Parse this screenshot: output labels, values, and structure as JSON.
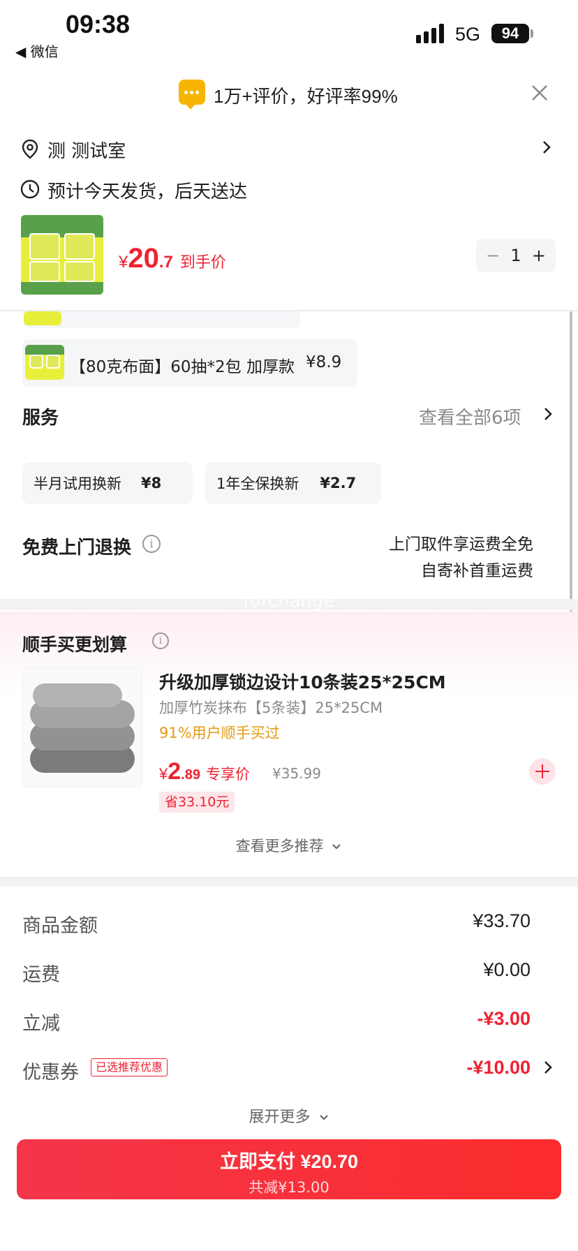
{
  "status_bar": {
    "time": "09:38",
    "back_label": "◀ 微信",
    "network": "5G",
    "battery": "94"
  },
  "review_banner": {
    "text": "1万+评价，好评率99%"
  },
  "address": {
    "text": "测 测试室"
  },
  "delivery": {
    "text": "预计今天发货，后天送达"
  },
  "product": {
    "price_currency": "¥",
    "price_integer": "20",
    "price_decimal": ".7",
    "price_tag": "到手价",
    "quantity": "1",
    "minus": "−",
    "plus": "+"
  },
  "sku": {
    "option_label": "【80克布面】60抽*2包 加厚款",
    "option_price": "¥8.9"
  },
  "services": {
    "title": "服务",
    "view_all": "查看全部6项",
    "chips": [
      {
        "name": "半月试用换新",
        "price": "¥8"
      },
      {
        "name": "1年全保换新",
        "price": "¥2.7"
      }
    ],
    "return_title": "免费上门退换",
    "return_line1": "上门取件享运费全免",
    "return_line2": "自寄补首重运费"
  },
  "watermark": "forchange",
  "recommend": {
    "title": "顺手买更划算",
    "item_name": "升级加厚锁边设计10条装25*25CM",
    "item_sub": "加厚竹炭抹布【5条装】25*25CM",
    "item_bought": "91%用户顺手买过",
    "price_currency": "¥",
    "price_integer": "2",
    "price_decimal": ".89",
    "price_tag": "专享价",
    "original_price": "¥35.99",
    "save": "省33.10元",
    "more": "查看更多推荐"
  },
  "totals": {
    "goods_label": "商品金额",
    "goods_value": "¥33.70",
    "shipping_label": "运费",
    "shipping_value": "¥0.00",
    "discount_label": "立减",
    "discount_value": "-¥3.00",
    "coupon_label": "优惠券",
    "coupon_badge": "已选推荐优惠",
    "coupon_value": "-¥10.00",
    "expand": "展开更多"
  },
  "pay": {
    "main": "立即支付 ¥20.70",
    "sub": "共减¥13.00"
  },
  "colors": {
    "accent_red": "#ee2233",
    "banner_yellow": "#f7b500",
    "bought_orange": "#e39a12"
  },
  "icons": [
    "location-pin-icon",
    "clock-icon",
    "close-icon",
    "chevron-right-icon",
    "info-icon",
    "chevron-down-icon",
    "plus-icon",
    "chat-bubble-icon"
  ]
}
